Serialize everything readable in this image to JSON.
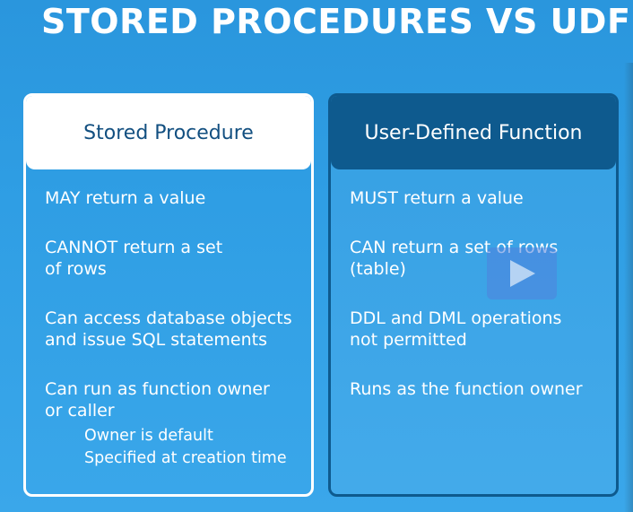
{
  "slide": {
    "title": "STORED PROCEDURES VS UDFS",
    "left_card": {
      "header": "Stored Procedure",
      "items": [
        {
          "lines": [
            "MAY return a value"
          ]
        },
        {
          "lines": [
            "CANNOT return a set",
            "of rows"
          ]
        },
        {
          "lines": [
            "Can access database objects",
            "and issue SQL statements"
          ]
        },
        {
          "lines": [
            "Can run as function owner",
            "or caller"
          ],
          "subitems": [
            "Owner is default",
            "Specified at creation time"
          ]
        }
      ]
    },
    "right_card": {
      "header": "User-Defined Function",
      "items": [
        {
          "lines": [
            "MUST return a value"
          ]
        },
        {
          "lines": [
            "CAN return a set of rows",
            "(table)"
          ]
        },
        {
          "lines": [
            "DDL and DML operations",
            "not permitted"
          ]
        },
        {
          "lines": [
            "Runs as the function owner"
          ]
        }
      ]
    }
  },
  "overlay": {
    "icon": "play-icon"
  },
  "colors": {
    "background": "#2f9ee4",
    "dark_blue": "#0e5a8e",
    "header_text_left": "#124f80",
    "white": "#ffffff"
  }
}
